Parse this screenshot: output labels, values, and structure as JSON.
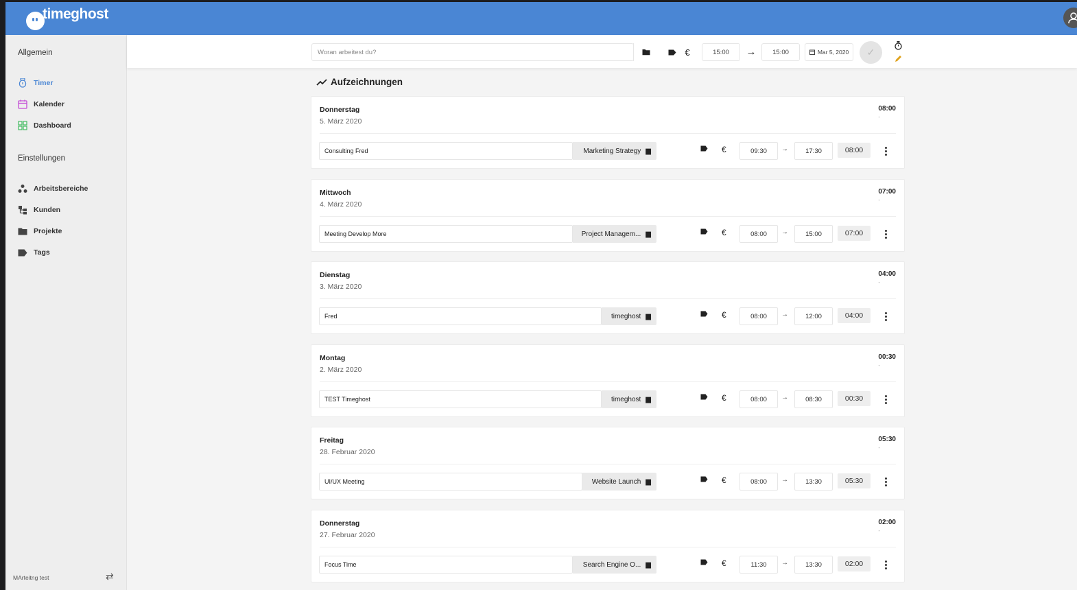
{
  "app": {
    "logo_text": "timeghost"
  },
  "sidebar": {
    "section_general": "Allgemein",
    "items_general": [
      {
        "label": "Timer",
        "icon": "stopwatch-icon",
        "active": true
      },
      {
        "label": "Kalender",
        "icon": "calendar-icon"
      },
      {
        "label": "Dashboard",
        "icon": "grid-icon"
      }
    ],
    "section_settings": "Einstellungen",
    "items_settings": [
      {
        "label": "Arbeitsbereiche",
        "icon": "workspace-icon"
      },
      {
        "label": "Kunden",
        "icon": "clients-icon"
      },
      {
        "label": "Projekte",
        "icon": "folder-icon"
      },
      {
        "label": "Tags",
        "icon": "tag-icon"
      }
    ],
    "footer_workspace": "MArteitng test"
  },
  "entry": {
    "placeholder": "Woran arbeitest du?",
    "start": "15:00",
    "end": "15:00",
    "date": "Mar 5, 2020"
  },
  "records": {
    "title": "Aufzeichnungen",
    "days": [
      {
        "day": "Donnerstag",
        "date": "5. März 2020",
        "total": "08:00",
        "dash": "-",
        "entry": {
          "desc": "Consulting Fred",
          "project": "Marketing Strategy",
          "start": "09:30",
          "end": "17:30",
          "duration": "08:00"
        }
      },
      {
        "day": "Mittwoch",
        "date": "4. März 2020",
        "total": "07:00",
        "dash": "-",
        "entry": {
          "desc": "Meeting Develop More",
          "project": "Project Managem...",
          "start": "08:00",
          "end": "15:00",
          "duration": "07:00"
        }
      },
      {
        "day": "Dienstag",
        "date": "3. März 2020",
        "total": "04:00",
        "dash": "-",
        "entry": {
          "desc": "Fred",
          "project": "timeghost",
          "start": "08:00",
          "end": "12:00",
          "duration": "04:00"
        }
      },
      {
        "day": "Montag",
        "date": "2. März 2020",
        "total": "00:30",
        "dash": "-",
        "entry": {
          "desc": "TEST Timeghost",
          "project": "timeghost",
          "start": "08:00",
          "end": "08:30",
          "duration": "00:30"
        }
      },
      {
        "day": "Freitag",
        "date": "28. Februar 2020",
        "total": "05:30",
        "dash": "-",
        "entry": {
          "desc": "UI/UX Meeting",
          "project": "Website Launch",
          "start": "08:00",
          "end": "13:30",
          "duration": "05:30"
        }
      },
      {
        "day": "Donnerstag",
        "date": "27. Februar 2020",
        "total": "02:00",
        "dash": "-",
        "entry": {
          "desc": "Focus Time",
          "project": "Search Engine O...",
          "start": "11:30",
          "end": "13:30",
          "duration": "02:00"
        }
      }
    ]
  },
  "colors": {
    "brand": "#4a86d4",
    "sidebar_bg": "#eeeeee",
    "page_bg": "#f4f4f4"
  }
}
